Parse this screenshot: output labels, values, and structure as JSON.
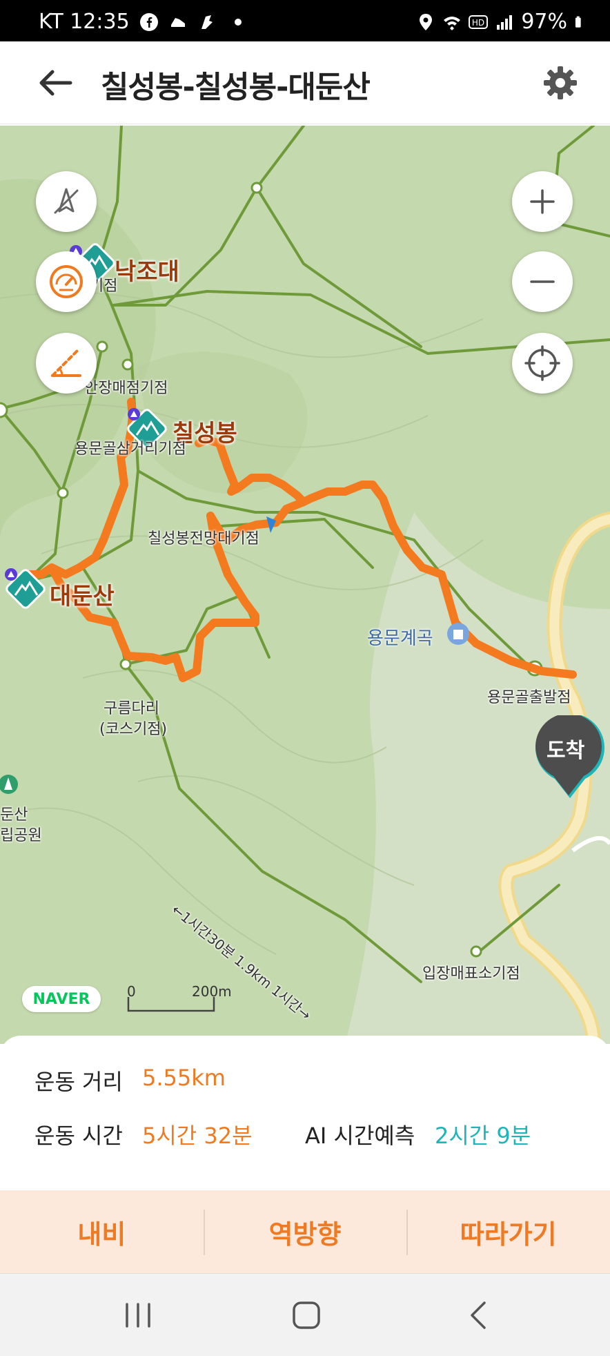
{
  "status_bar": {
    "carrier_time": "KT 12:35",
    "battery": "97%",
    "icons": [
      "facebook-icon",
      "shoe-icon",
      "bird-icon",
      "location-icon",
      "wifi-icon",
      "hd-icon",
      "signal-icon",
      "battery-icon"
    ]
  },
  "header": {
    "title": "칠성봉-칠성봉-대둔산",
    "back_icon": "arrow-left-icon",
    "settings_icon": "gear-icon"
  },
  "map": {
    "labels": {
      "peak_najodae": "낙조대",
      "peak_chilseongbong": "칠성봉",
      "peak_daedunsan": "대둔산",
      "waypoint_gijeom": "기점",
      "waypoint_anjang": "안장매점기점",
      "waypoint_yongmungol": "용문골삼거리기점",
      "waypoint_chilseong_view": "칠성봉전망대기점",
      "valley": "용문계곡",
      "start_point": "용문골출발점",
      "cloud_bridge": "구름다리",
      "course_point": "(코스기점)",
      "park_line1": "둔산",
      "park_line2": "립공원",
      "trail_annotation": "←1시간30분 1.9km 1시간→",
      "ticket_office": "입장매표소기점",
      "arrive_badge": "도착"
    },
    "brand": "NAVER",
    "scale": {
      "start": "0",
      "end": "200m"
    },
    "colors": {
      "route": "#f47a20",
      "trail": "#6e9a3a",
      "road": "#f7e3a0",
      "map_bg": "#c9dbb3",
      "peak_marker": "#1f9e96",
      "arrive_pin": "#4d4d4d",
      "arrive_pin_accent": "#1eb4b8"
    }
  },
  "stats": {
    "distance_label": "운동 거리",
    "distance_value": "5.55km",
    "time_label": "운동 시간",
    "time_value": "5시간 32분",
    "ai_label": "AI 시간예측",
    "ai_value": "2시간 9분"
  },
  "actions": {
    "navigate": "내비",
    "reverse": "역방향",
    "follow": "따라가기"
  },
  "nav": {
    "recents_icon": "recents-icon",
    "home_icon": "home-icon",
    "back_icon": "back-icon"
  }
}
